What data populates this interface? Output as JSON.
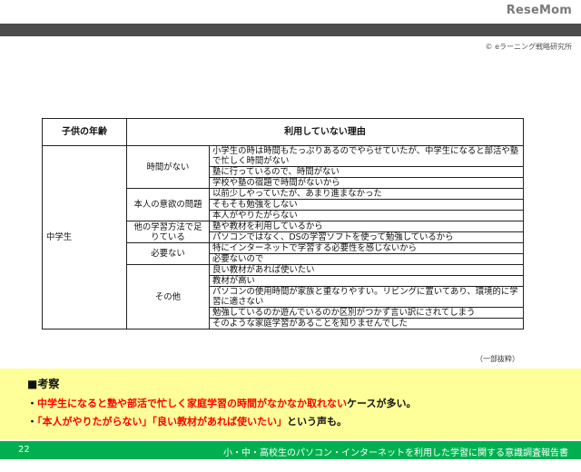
{
  "brand": {
    "logo": "ReseMom"
  },
  "slide": {
    "copyright": "© eラーニング戦略研究所",
    "table": {
      "headers": [
        "子供の年齢",
        "利用していない理由"
      ],
      "age_group": "中学生",
      "categories": [
        {
          "label": "時間がない",
          "reasons": [
            "小学生の時は時間もたっぷりあるのでやらせていたが、中学生になると部活や塾で忙しく時間がない",
            "塾に行っているので、時間がない",
            "学校や塾の宿題で時間がないから"
          ]
        },
        {
          "label": "本人の意欲の問題",
          "reasons": [
            "以前少しやっていたが、あまり進まなかった",
            "そもそも勉強をしない",
            "本人がやりたがらない"
          ]
        },
        {
          "label": "他の学習方法で足りている",
          "reasons": [
            "塾や教材を利用しているから",
            "パソコンではなく、DSの学習ソフトを使って勉強しているから"
          ]
        },
        {
          "label": "必要ない",
          "reasons": [
            "特にインターネットで学習する必要性を感じないから",
            "必要ないので"
          ]
        },
        {
          "label": "その他",
          "reasons": [
            "良い教材があれば使いたい",
            "教材が高い",
            "パソコンの使用時間が家族と重なりやすい。リビングに置いてあり、環境的に学習に適さない",
            "勉強しているのか遊んでいるのか区別がつかず言い訳にされてしまう",
            "そのような家庭学習があることを知りませんでした"
          ]
        }
      ]
    },
    "note": "（一部抜粋）",
    "consideration": {
      "title": "■考察",
      "line1_bullet": "・",
      "line1_red": "中学生になると塾や部活で忙しく家庭学習の時間がなかなか取れない",
      "line1_rest": "ケースが多い。",
      "line2_bullet": "・",
      "line2_q1": "「本人がやりたがらない」",
      "line2_q2": "「良い教材があれば使いたい」",
      "line2_rest": "という声も。"
    },
    "footer": {
      "page": "22",
      "title": "小・中・高校生のパソコン・インターネットを利用した学習に関する意識調査報告書"
    }
  },
  "colors": {
    "accent_green": "#00b050",
    "panel_yellow": "#ffff99",
    "highlight_red": "#ff0000"
  }
}
